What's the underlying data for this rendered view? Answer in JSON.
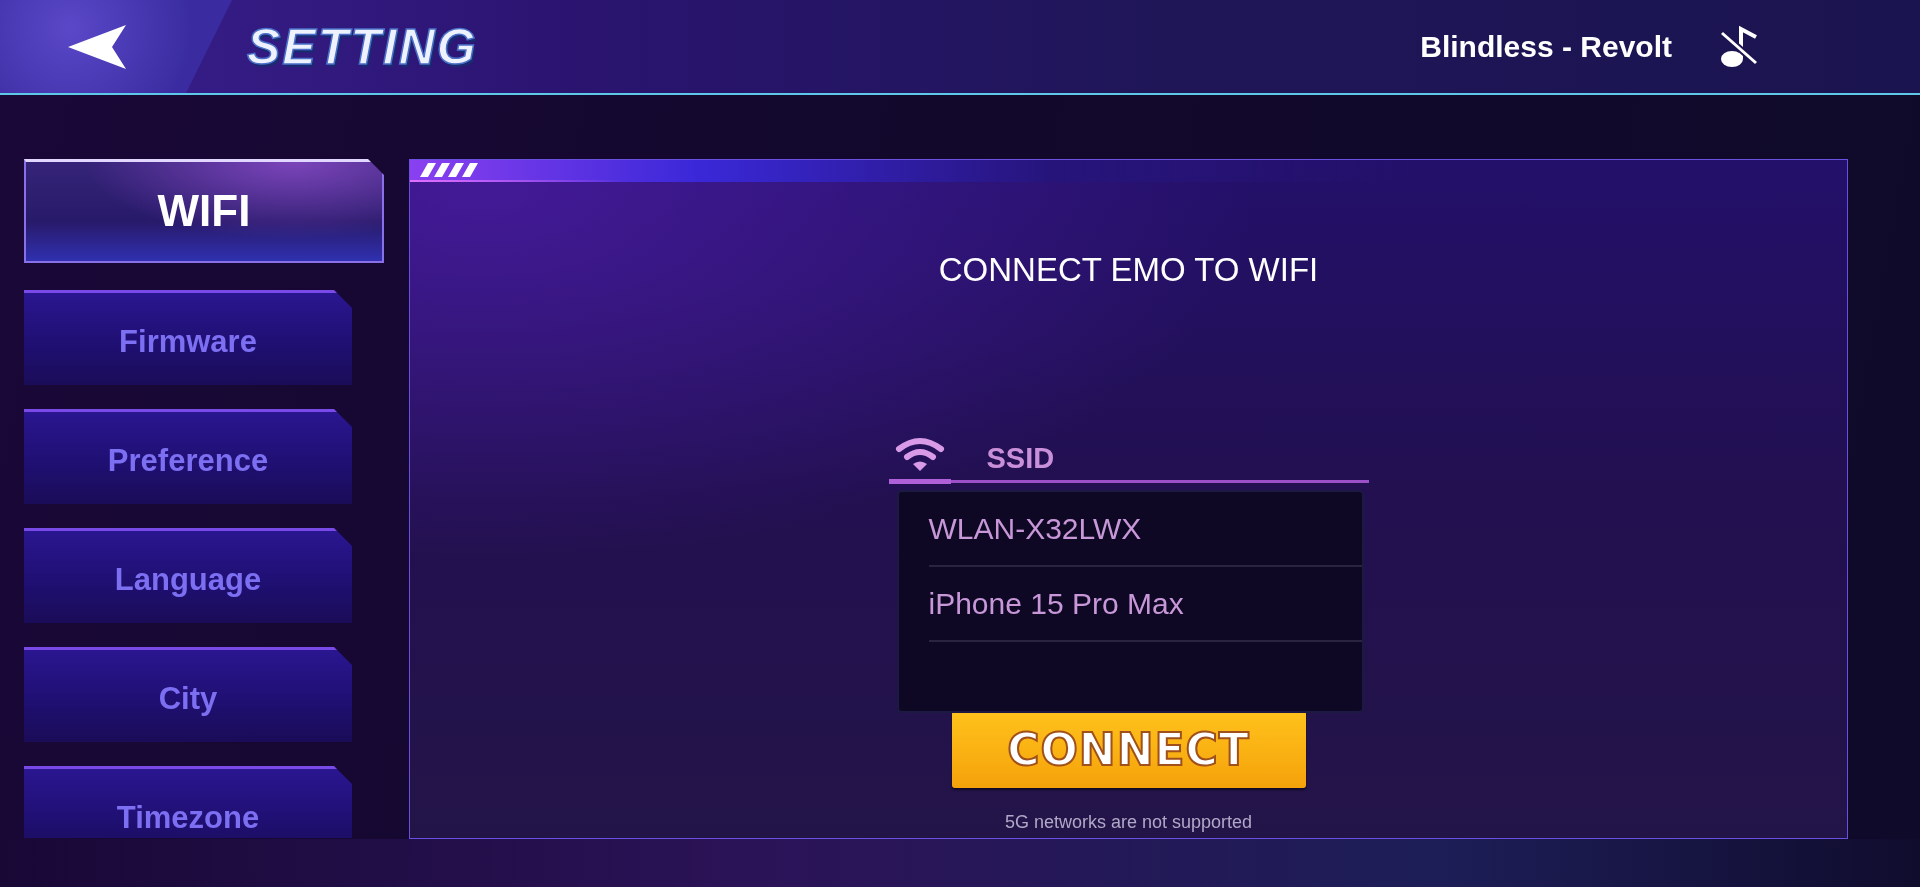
{
  "header": {
    "title": "SETTING",
    "now_playing": "Blindless - Revolt",
    "music_muted": true
  },
  "sidebar": {
    "items": [
      {
        "label": "WIFI",
        "selected": true
      },
      {
        "label": "Firmware",
        "selected": false
      },
      {
        "label": "Preference",
        "selected": false
      },
      {
        "label": "Language",
        "selected": false
      },
      {
        "label": "City",
        "selected": false
      },
      {
        "label": "Timezone",
        "selected": false
      }
    ]
  },
  "panel": {
    "title": "CONNECT EMO TO WIFI",
    "ssid_field": {
      "placeholder": "SSID"
    },
    "dropdown": {
      "options": [
        "WLAN-X32LWX",
        "iPhone 15 Pro Max"
      ]
    },
    "connect_button": "CONNECT",
    "note": "5G networks are not supported"
  }
}
